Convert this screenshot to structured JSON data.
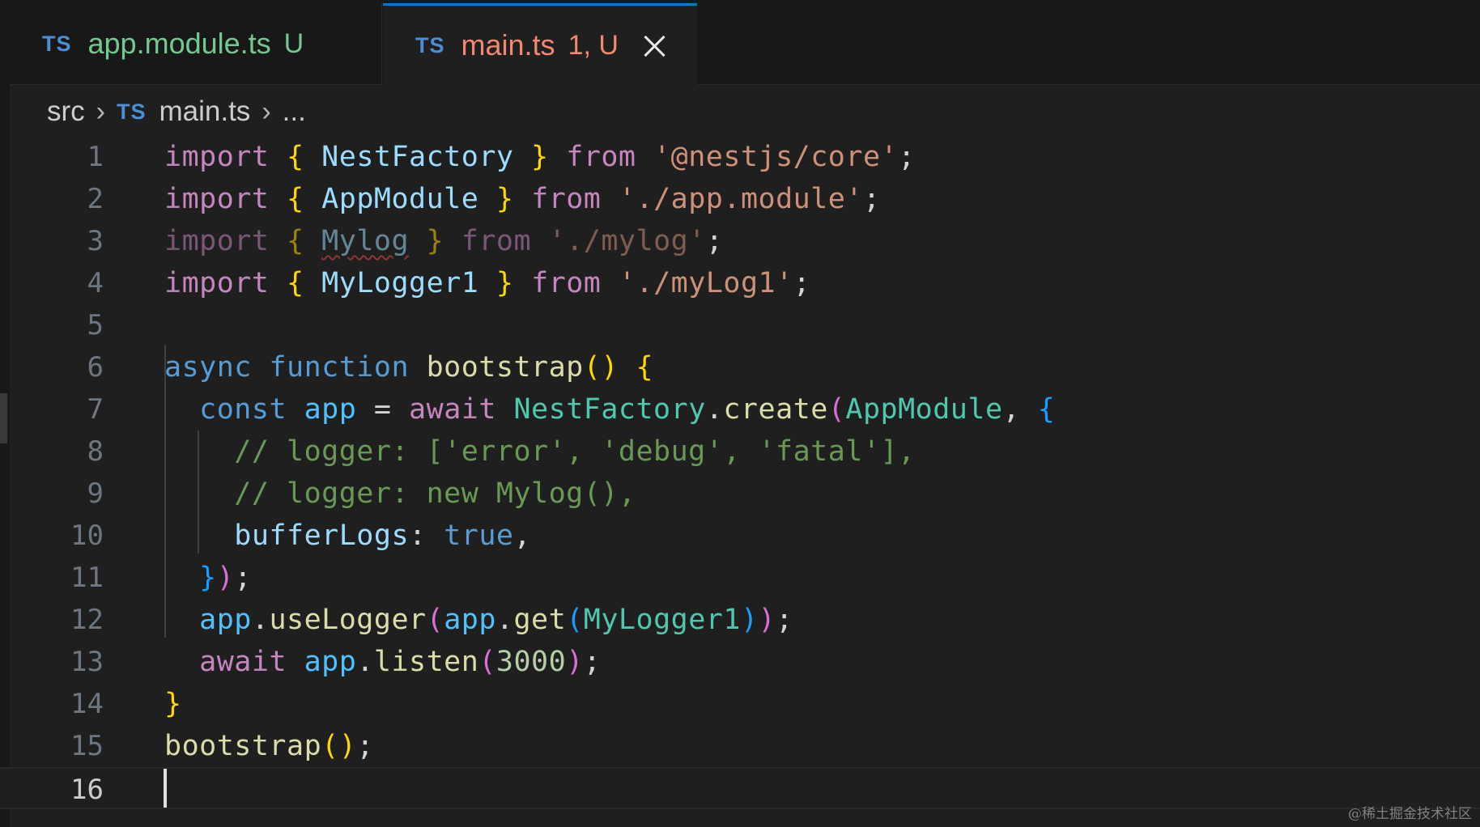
{
  "tabs": [
    {
      "icon": "TS",
      "name": "app.module.ts",
      "status": "U",
      "active": false
    },
    {
      "icon": "TS",
      "name": "main.ts",
      "status": "1, U",
      "active": true
    }
  ],
  "breadcrumb": {
    "folder": "src",
    "icon": "TS",
    "file": "main.ts",
    "more": "..."
  },
  "line_numbers": [
    "1",
    "2",
    "3",
    "4",
    "5",
    "6",
    "7",
    "8",
    "9",
    "10",
    "11",
    "12",
    "13",
    "14",
    "15",
    "16"
  ],
  "current_line": 16,
  "code": {
    "import_kw": "import",
    "from_kw": "from",
    "l1_name": "NestFactory",
    "l1_path": "'@nestjs/core'",
    "l2_name": "AppModule",
    "l2_path": "'./app.module'",
    "l3_name": "Mylog",
    "l3_path": "'./mylog'",
    "l4_name": "MyLogger1",
    "l4_path": "'./myLog1'",
    "async_kw": "async",
    "function_kw": "function",
    "fn_name": "bootstrap",
    "const_kw": "const",
    "app_var": "app",
    "await_kw": "await",
    "create_fn": "create",
    "comment1": "// logger: ['error', 'debug', 'fatal'],",
    "comment2": "// logger: new Mylog(),",
    "buffer_prop": "bufferLogs",
    "true_kw": "true",
    "uselogger_fn": "useLogger",
    "get_fn": "get",
    "listen_fn": "listen",
    "port": "3000"
  },
  "watermark": "@稀土掘金技术社区",
  "colors": {
    "accent": "#0078d4",
    "untracked": "#73c991",
    "error_file": "#f48771"
  }
}
